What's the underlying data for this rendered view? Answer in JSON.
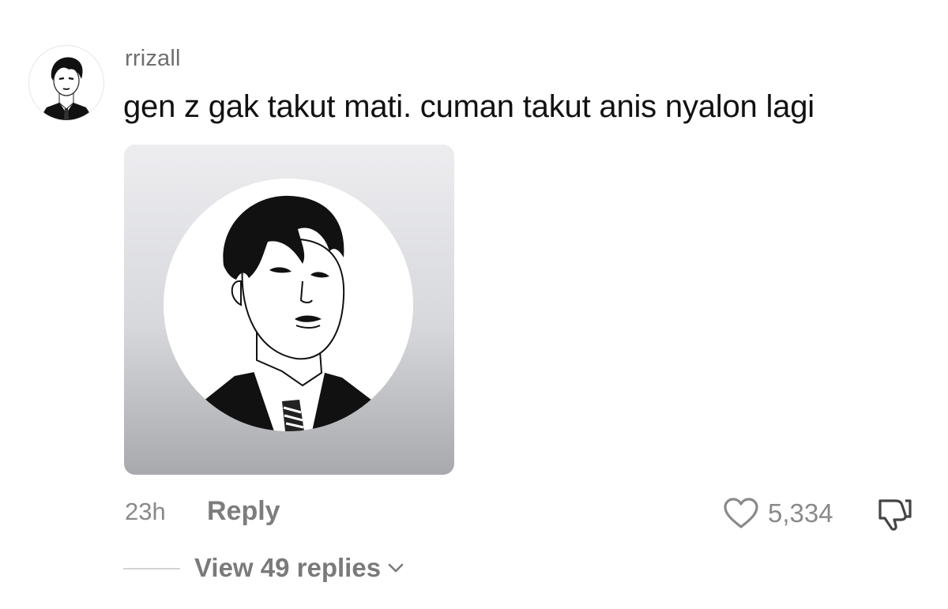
{
  "comment": {
    "username": "rrizall",
    "text": "gen z gak takut mati. cuman takut anis nyalon lagi",
    "timestamp": "23h",
    "reply_label": "Reply",
    "like_count": "5,334",
    "view_replies_label": "View 49 replies"
  },
  "icons": {
    "avatar": "profile-portrait",
    "sticker": "portrait-sticker",
    "like": "heart-outline-icon",
    "dislike": "thumbs-down-outline-icon",
    "expand": "chevron-down-icon"
  },
  "colors": {
    "text_primary": "#111111",
    "text_secondary": "#8a8a8a",
    "background": "#ffffff"
  }
}
